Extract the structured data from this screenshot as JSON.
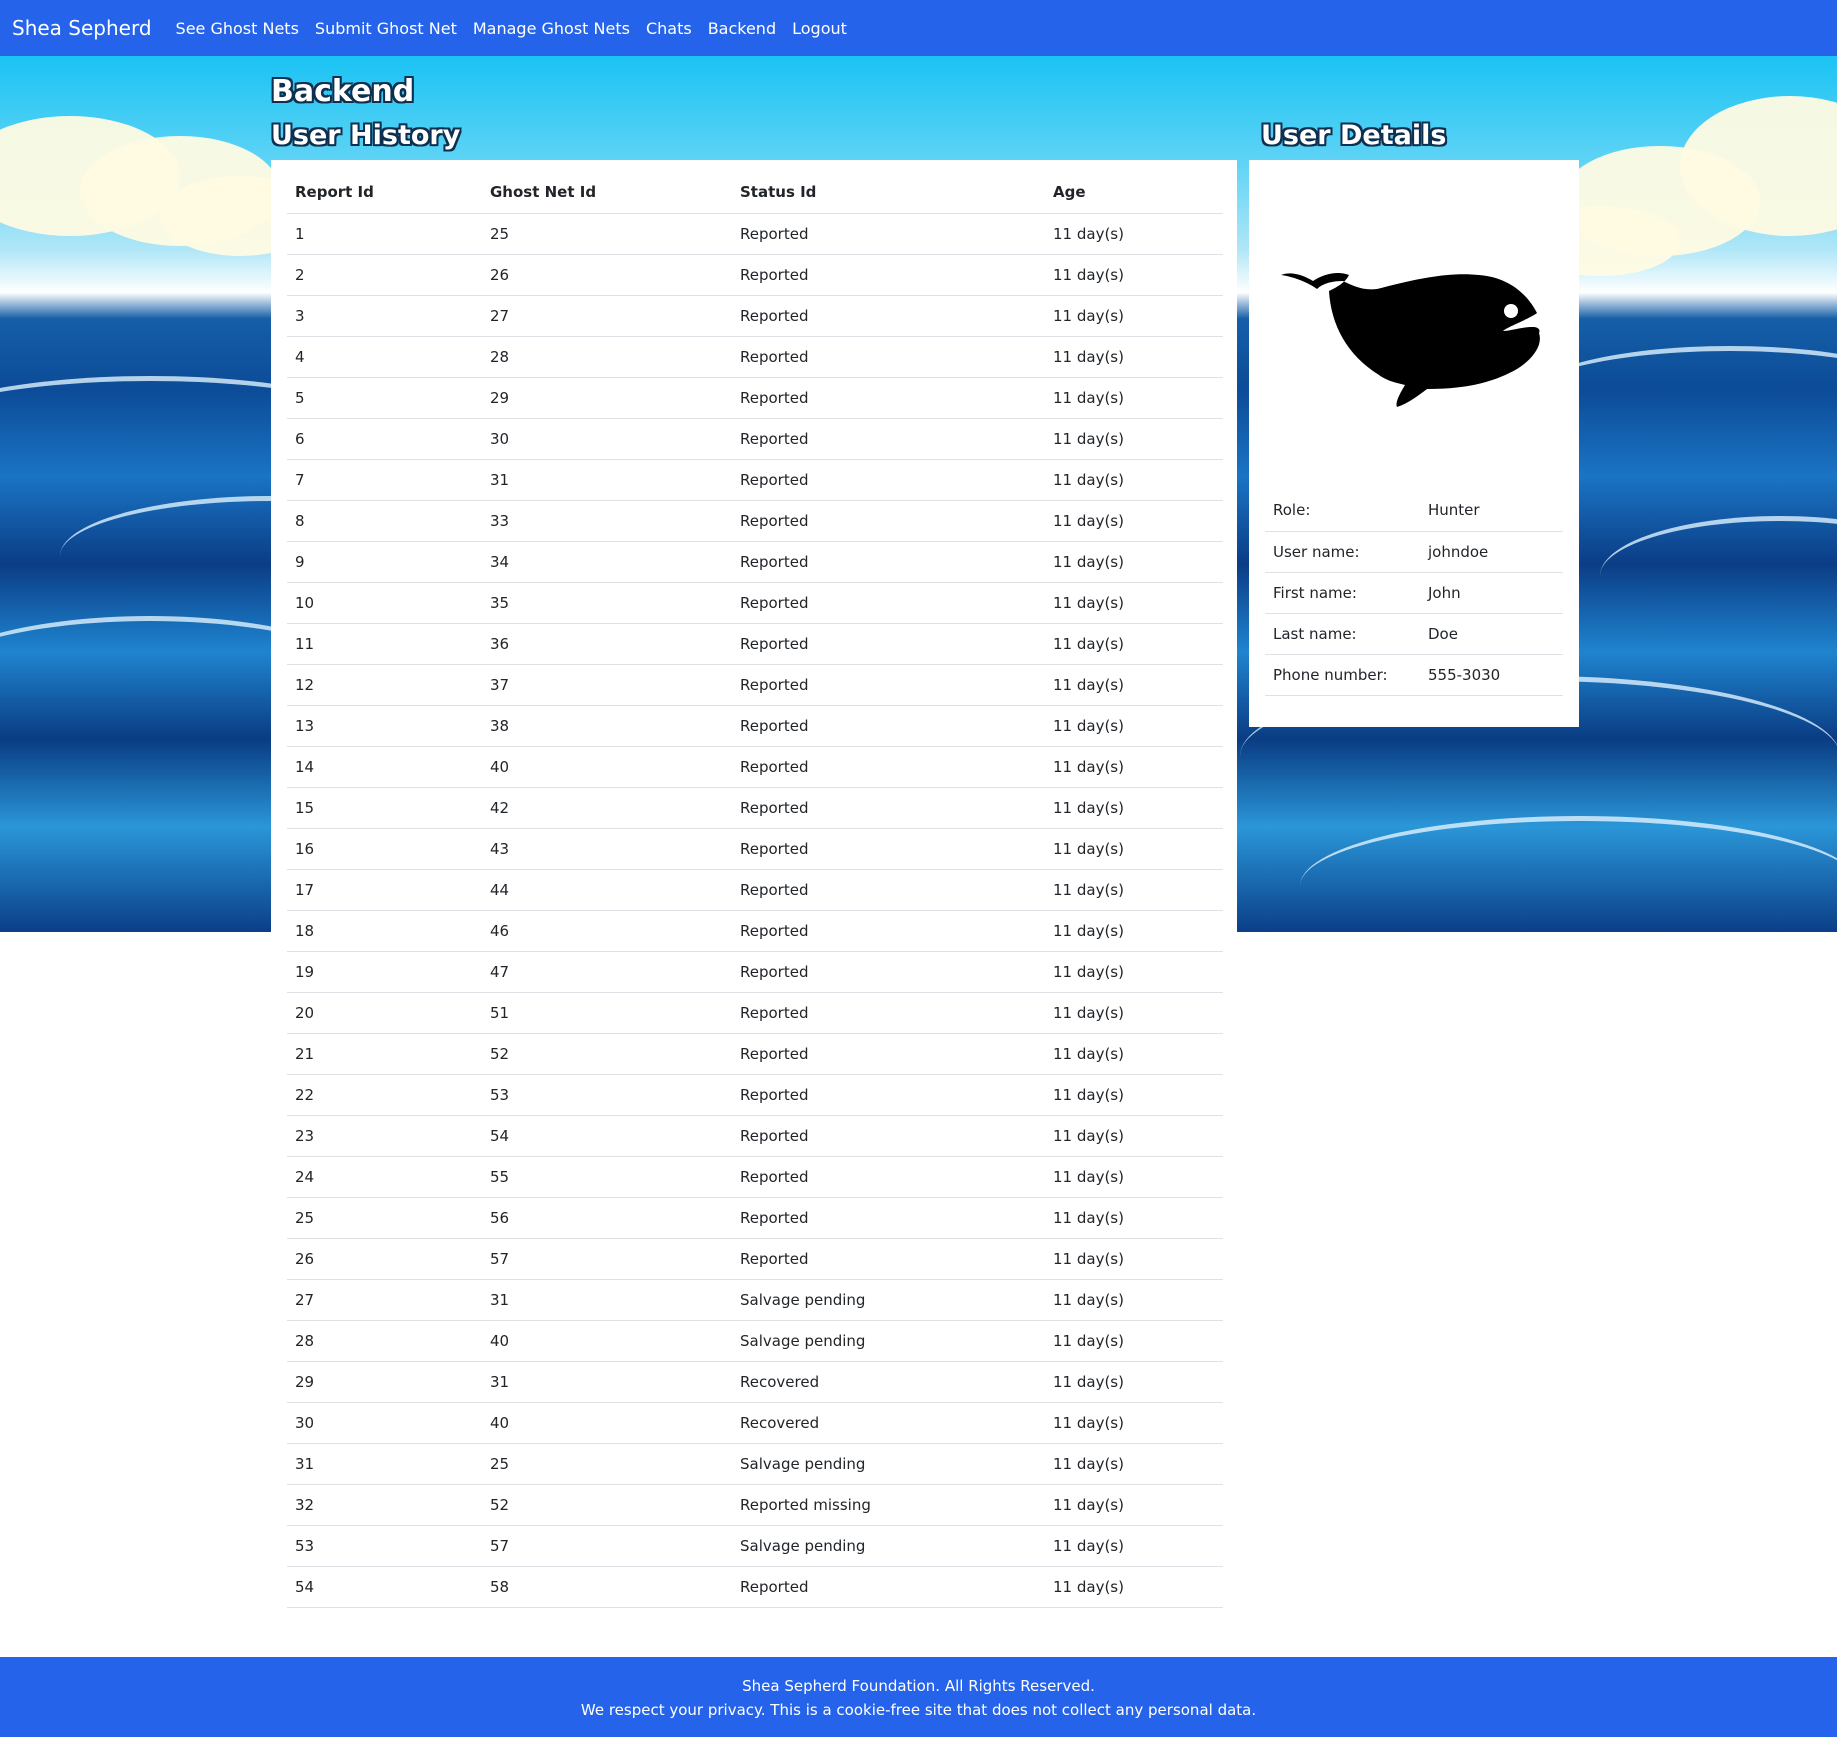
{
  "nav": {
    "brand": "Shea Sepherd",
    "links": [
      "See Ghost Nets",
      "Submit Ghost Net",
      "Manage Ghost Nets",
      "Chats",
      "Backend",
      "Logout"
    ]
  },
  "page": {
    "title": "Backend",
    "history_title": "User History",
    "details_title": "User Details"
  },
  "history": {
    "headers": [
      "Report Id",
      "Ghost Net Id",
      "Status Id",
      "Age"
    ],
    "rows": [
      [
        "1",
        "25",
        "Reported",
        "11 day(s)"
      ],
      [
        "2",
        "26",
        "Reported",
        "11 day(s)"
      ],
      [
        "3",
        "27",
        "Reported",
        "11 day(s)"
      ],
      [
        "4",
        "28",
        "Reported",
        "11 day(s)"
      ],
      [
        "5",
        "29",
        "Reported",
        "11 day(s)"
      ],
      [
        "6",
        "30",
        "Reported",
        "11 day(s)"
      ],
      [
        "7",
        "31",
        "Reported",
        "11 day(s)"
      ],
      [
        "8",
        "33",
        "Reported",
        "11 day(s)"
      ],
      [
        "9",
        "34",
        "Reported",
        "11 day(s)"
      ],
      [
        "10",
        "35",
        "Reported",
        "11 day(s)"
      ],
      [
        "11",
        "36",
        "Reported",
        "11 day(s)"
      ],
      [
        "12",
        "37",
        "Reported",
        "11 day(s)"
      ],
      [
        "13",
        "38",
        "Reported",
        "11 day(s)"
      ],
      [
        "14",
        "40",
        "Reported",
        "11 day(s)"
      ],
      [
        "15",
        "42",
        "Reported",
        "11 day(s)"
      ],
      [
        "16",
        "43",
        "Reported",
        "11 day(s)"
      ],
      [
        "17",
        "44",
        "Reported",
        "11 day(s)"
      ],
      [
        "18",
        "46",
        "Reported",
        "11 day(s)"
      ],
      [
        "19",
        "47",
        "Reported",
        "11 day(s)"
      ],
      [
        "20",
        "51",
        "Reported",
        "11 day(s)"
      ],
      [
        "21",
        "52",
        "Reported",
        "11 day(s)"
      ],
      [
        "22",
        "53",
        "Reported",
        "11 day(s)"
      ],
      [
        "23",
        "54",
        "Reported",
        "11 day(s)"
      ],
      [
        "24",
        "55",
        "Reported",
        "11 day(s)"
      ],
      [
        "25",
        "56",
        "Reported",
        "11 day(s)"
      ],
      [
        "26",
        "57",
        "Reported",
        "11 day(s)"
      ],
      [
        "27",
        "31",
        "Salvage pending",
        "11 day(s)"
      ],
      [
        "28",
        "40",
        "Salvage pending",
        "11 day(s)"
      ],
      [
        "29",
        "31",
        "Recovered",
        "11 day(s)"
      ],
      [
        "30",
        "40",
        "Recovered",
        "11 day(s)"
      ],
      [
        "31",
        "25",
        "Salvage pending",
        "11 day(s)"
      ],
      [
        "32",
        "52",
        "Reported missing",
        "11 day(s)"
      ],
      [
        "53",
        "57",
        "Salvage pending",
        "11 day(s)"
      ],
      [
        "54",
        "58",
        "Reported",
        "11 day(s)"
      ]
    ]
  },
  "details": {
    "avatar_icon": "whale-icon",
    "rows": [
      [
        "Role:",
        "Hunter"
      ],
      [
        "User name:",
        "johndoe"
      ],
      [
        "First name:",
        "John"
      ],
      [
        "Last name:",
        "Doe"
      ],
      [
        "Phone number:",
        "555-3030"
      ]
    ]
  },
  "footer": {
    "line1": "Shea Sepherd Foundation. All Rights Reserved.",
    "line2": "We respect your privacy. This is a cookie-free site that does not collect any personal data."
  },
  "colors": {
    "nav_bg": "#2563eb",
    "footer_bg": "#2563eb"
  }
}
